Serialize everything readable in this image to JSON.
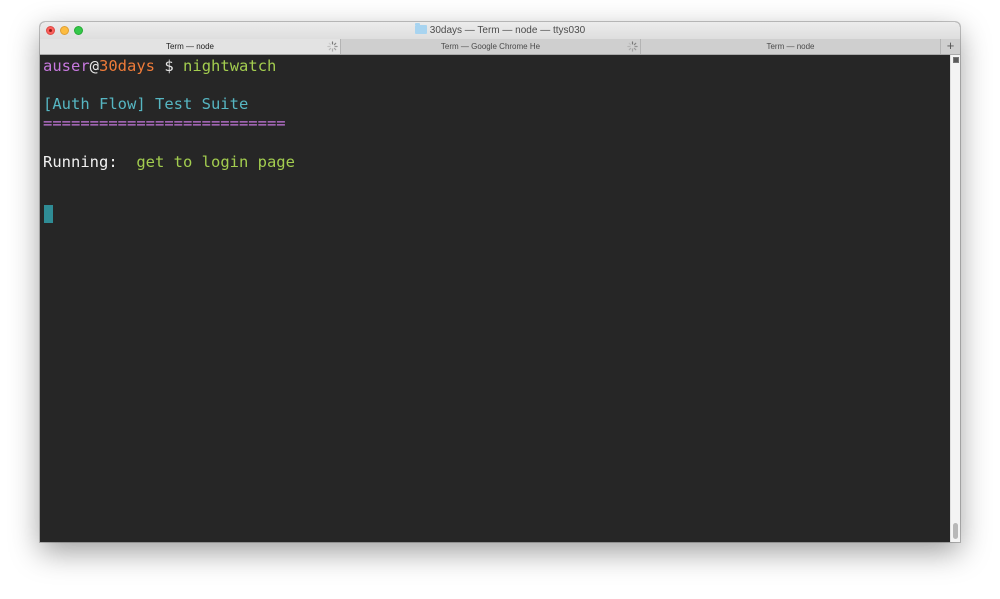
{
  "window": {
    "title": "30days — Term — node — ttys030"
  },
  "tabs": [
    {
      "label": "Term — node",
      "active": true,
      "loading": true
    },
    {
      "label": "Term — Google Chrome He",
      "active": false,
      "loading": true
    },
    {
      "label": "Term — node",
      "active": false,
      "loading": false
    }
  ],
  "new_tab_label": "+",
  "terminal": {
    "prompt_user": "auser",
    "prompt_at": "@",
    "prompt_host": "30days",
    "prompt_symbol": "$",
    "command": "nightwatch",
    "suite_title": "[Auth Flow] Test Suite",
    "suite_rule": "==========================",
    "running_label": "Running:",
    "running_test": "get to login page"
  },
  "colors": {
    "background": "#262626",
    "user": "#c678dd",
    "host": "#ee7b39",
    "command": "#a3cd4f",
    "suite": "#56b6c2",
    "cursor": "#2f8c95"
  },
  "icons": {
    "title": "folder-icon",
    "tab_loading": "spinner-icon",
    "scroll": "scroll-top-icon"
  }
}
